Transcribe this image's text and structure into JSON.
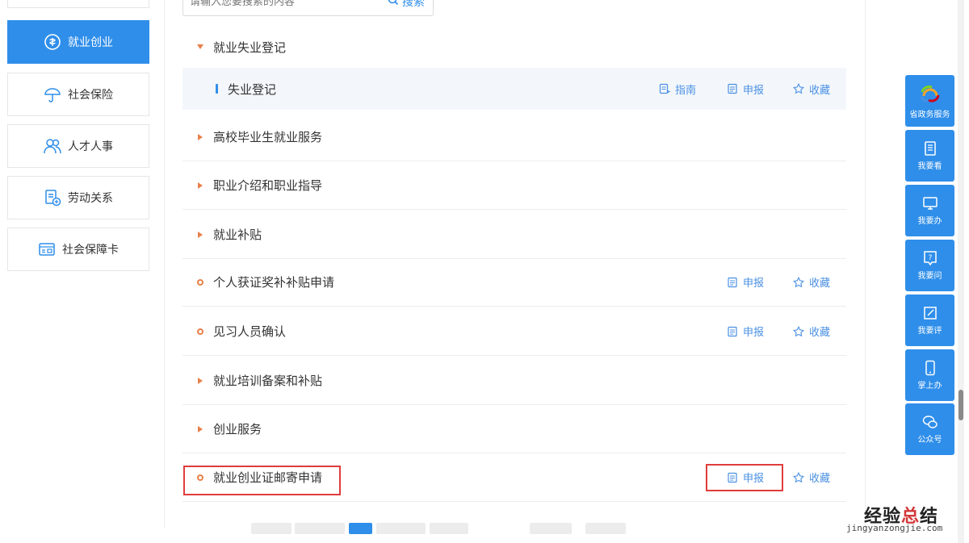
{
  "search": {
    "placeholder": "请输入您要搜索的内容",
    "button_label": "搜索"
  },
  "sidebar": {
    "items": [
      {
        "label": "就业创业",
        "icon": "money-bag-icon",
        "active": true
      },
      {
        "label": "社会保险",
        "icon": "umbrella-icon",
        "active": false
      },
      {
        "label": "人才人事",
        "icon": "people-icon",
        "active": false
      },
      {
        "label": "劳动关系",
        "icon": "document-plus-icon",
        "active": false
      },
      {
        "label": "社会保障卡",
        "icon": "card-icon",
        "active": false
      }
    ]
  },
  "list": {
    "rows": [
      {
        "label": "就业失业登记",
        "marker": "expanded"
      },
      {
        "label": "失业登记",
        "marker": "sub",
        "actions": [
          "指南",
          "申报",
          "收藏"
        ]
      },
      {
        "label": "高校毕业生就业服务",
        "marker": "collapsed"
      },
      {
        "label": "职业介绍和职业指导",
        "marker": "collapsed"
      },
      {
        "label": "就业补贴",
        "marker": "collapsed"
      },
      {
        "label": "个人获证奖补补贴申请",
        "marker": "item",
        "actions": [
          "申报",
          "收藏"
        ]
      },
      {
        "label": "见习人员确认",
        "marker": "item",
        "actions": [
          "申报",
          "收藏"
        ]
      },
      {
        "label": "就业培训备案和补贴",
        "marker": "collapsed"
      },
      {
        "label": "创业服务",
        "marker": "collapsed"
      },
      {
        "label": "就业创业证邮寄申请",
        "marker": "item",
        "actions": [
          "申报",
          "收藏"
        ]
      }
    ]
  },
  "float_toolbar": {
    "items": [
      {
        "label": "省政务服务",
        "icon": "gov-logo-icon"
      },
      {
        "label": "我要看",
        "icon": "book-icon"
      },
      {
        "label": "我要办",
        "icon": "monitor-icon"
      },
      {
        "label": "我要问",
        "icon": "question-icon"
      },
      {
        "label": "我要评",
        "icon": "edit-icon"
      },
      {
        "label": "掌上办",
        "icon": "phone-icon"
      },
      {
        "label": "公众号",
        "icon": "wechat-icon"
      }
    ]
  },
  "watermark": {
    "main_prefix": "经验",
    "main_accent": "总",
    "main_suffix": "结",
    "url": "jingyanzongjie.com"
  },
  "colors": {
    "primary": "#2f8eea",
    "marker": "#e8804a",
    "highlight": "#e03c3c"
  }
}
